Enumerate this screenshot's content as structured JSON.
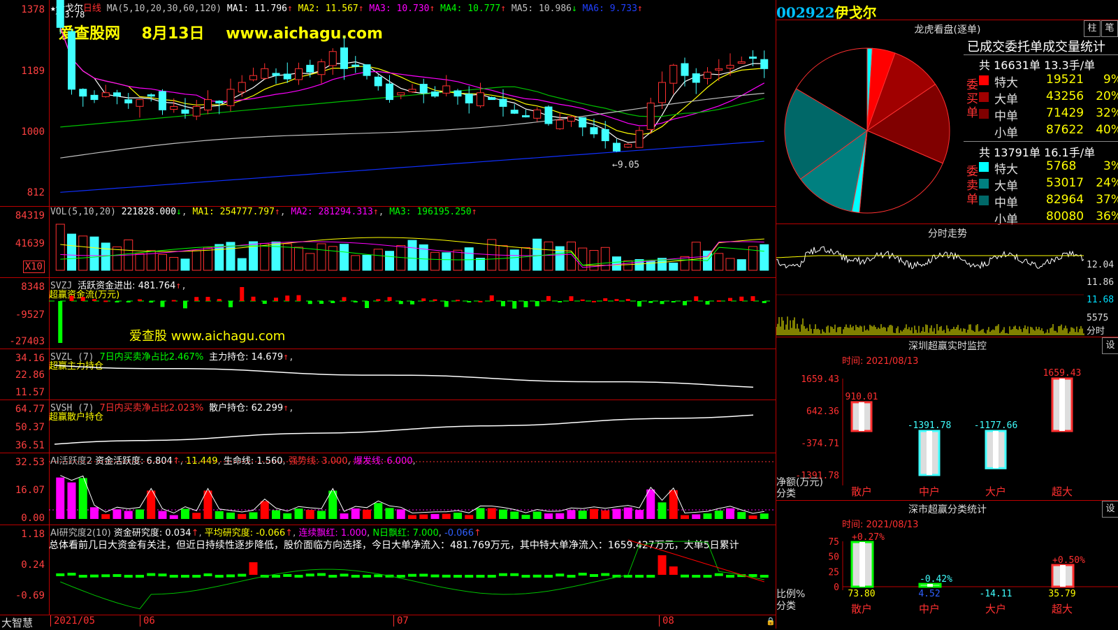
{
  "header": {
    "star": "★",
    "stock_name": "伊戈尔",
    "period": "日线",
    "ma_params": "MA(5,10,20,30,60,120)",
    "ma": [
      {
        "label": "MA1:",
        "value": "11.796",
        "arrow": "↑",
        "color": "#ffffff"
      },
      {
        "label": "MA2:",
        "value": "11.567",
        "arrow": "↑",
        "color": "#ffff00"
      },
      {
        "label": "MA3:",
        "value": "10.730",
        "arrow": "↑",
        "color": "#ff00ff"
      },
      {
        "label": "MA4:",
        "value": "10.777",
        "arrow": "↑",
        "color": "#00ff00"
      },
      {
        "label": "MA5:",
        "value": "10.986",
        "arrow": "↓",
        "color": "#c0c0c0"
      },
      {
        "label": "MA6:",
        "value": "9.733",
        "arrow": "↑",
        "color": "#2040ff"
      }
    ],
    "high_marker": "13.78",
    "watermark": "爱查股网    8月13日    www.aichagu.com",
    "low_marker": "9.05"
  },
  "price_axis": [
    "1378",
    "1189",
    "1000",
    "812"
  ],
  "vol": {
    "header": "VOL(5,10,20)",
    "value": "221828.000",
    "arrow": "↓",
    "ma1": "MA1: 254777.797",
    "ma2": "MA2: 281294.313",
    "ma3": "MA3: 196195.250",
    "axis": [
      "84319",
      "41639"
    ],
    "unit": "X10"
  },
  "svzj": {
    "header": "SVZJ",
    "label": "活跃资金进出: 481.764",
    "sub": "超赢资金流(万元)",
    "axis": [
      "8348",
      "-9527",
      "-27403"
    ],
    "watermark": "爱查股 www.aichagu.com"
  },
  "svzl": {
    "header": "SVZL (7)",
    "ratio": "7日内买卖净占比2.467%",
    "label": "主力持仓: 14.679",
    "sub": "超赢主力持仓",
    "axis": [
      "34.16",
      "22.86",
      "11.57"
    ]
  },
  "svsh": {
    "header": "SVSH (7)",
    "ratio": "7日内买卖净占比2.023%",
    "label": "散户持仓: 62.299",
    "sub": "超赢散户持仓",
    "axis": [
      "64.77",
      "50.37",
      "36.51"
    ]
  },
  "ai_active": {
    "header": "AI活跃度2",
    "label": "资金活跃度: 6.804",
    "v2": "11.449",
    "life": "生命线: 1.560",
    "strong": "强势线: 3.000",
    "burst": "爆发线: 6.000",
    "axis": [
      "32.53",
      "16.07",
      "0.00"
    ]
  },
  "ai_research": {
    "header": "AI研究度2(10)",
    "label": "资金研究度: 0.034",
    "avg": "平均研究度: -0.066",
    "cont": "连续飘红: 1.000",
    "nday": "N日飘红: 7.000",
    "last": "-0.066",
    "text": "总体看前几日大资金有关注，但近日持续性逐步降低，股价面临方向选择，今日大单净流入：481.769万元，其中特大单净流入：1659.427万元，大单5日累计",
    "axis": [
      "1.18",
      "0.24",
      "-0.69"
    ]
  },
  "bottom_axis": {
    "brand": "大智慧",
    "dates": [
      "2021/05",
      "06",
      "07",
      "08"
    ]
  },
  "right": {
    "code": "002922",
    "name": "伊戈尔",
    "dragon_title": "龙虎看盘(逐单)",
    "btn_zhu": "柱",
    "btn_bi": "笔",
    "stat_title": "已成交委托单成交量统计",
    "buy_total": "共 16631单 13.3手/单",
    "buy_label": "委买单",
    "buy": [
      {
        "name": "特大",
        "value": "19521",
        "pct": "9%",
        "color": "#ff0000"
      },
      {
        "name": "大单",
        "value": "43256",
        "pct": "20%",
        "color": "#a00000"
      },
      {
        "name": "中单",
        "value": "71429",
        "pct": "32%",
        "color": "#800000"
      },
      {
        "name": "小单",
        "value": "87622",
        "pct": "40%",
        "color": "#000000"
      }
    ],
    "sell_total": "共 13791单 16.1手/单",
    "sell_label": "委卖单",
    "sell": [
      {
        "name": "特大",
        "value": "5768",
        "pct": "3%",
        "color": "#00ffff"
      },
      {
        "name": "大单",
        "value": "53017",
        "pct": "24%",
        "color": "#008080"
      },
      {
        "name": "中单",
        "value": "82964",
        "pct": "37%",
        "color": "#006868"
      },
      {
        "name": "小单",
        "value": "80080",
        "pct": "36%",
        "color": "#000000"
      }
    ],
    "pie_data": [
      {
        "pct": 1,
        "color": "#00ffff"
      },
      {
        "pct": 4.5,
        "color": "#ff0000"
      },
      {
        "pct": 10,
        "color": "#a00000"
      },
      {
        "pct": 16,
        "color": "#800000"
      },
      {
        "pct": 20,
        "color": "#000000"
      },
      {
        "pct": 1.5,
        "color": "#00ffff"
      },
      {
        "pct": 12,
        "color": "#008080"
      },
      {
        "pct": 18.5,
        "color": "#006868"
      },
      {
        "pct": 16.5,
        "color": "#000000"
      }
    ],
    "trend_title": "分时走势",
    "trend_axis": [
      "12.04",
      "11.86",
      "11.68"
    ],
    "trend_vol": "5575",
    "trend_vol_unit": "分时",
    "sz_title": "深圳超赢实时监控",
    "sz_btn": "设",
    "sz_time": "时间: 2021/08/13",
    "sz_axis": [
      "1659.43",
      "642.36",
      "-374.71",
      "-1391.78"
    ],
    "sz_unit1": "净额(万元)",
    "sz_unit2": "分类",
    "sz_bars": [
      {
        "cat": "散户",
        "value": 910.01,
        "label": "910.01"
      },
      {
        "cat": "中户",
        "value": -1391.78,
        "label": "-1391.78"
      },
      {
        "cat": "大户",
        "value": -1177.66,
        "label": "-1177.66"
      },
      {
        "cat": "超大",
        "value": 1659.43,
        "label": "1659.43"
      }
    ],
    "cls_title": "深市超赢分类统计",
    "cls_btn": "设",
    "cls_time": "时间: 2021/08/13",
    "cls_axis": [
      "75",
      "50",
      "25",
      "0"
    ],
    "cls_unit1": "比例%",
    "cls_unit2": "分类",
    "cls_bars": [
      {
        "cat": "散户",
        "ratio": 73.8,
        "label": "73.80",
        "pct": "+0.27%"
      },
      {
        "cat": "中户",
        "ratio": 4.52,
        "label": "4.52",
        "pct": "-0.42%"
      },
      {
        "cat": "大户",
        "ratio": -14.11,
        "label": "-14.11",
        "pct": ""
      },
      {
        "cat": "超大",
        "ratio": 35.79,
        "label": "35.79",
        "pct": "+0.50%"
      }
    ]
  },
  "chart_data": {
    "type": "bar",
    "title": "深圳超赢实时监控",
    "categories": [
      "散户",
      "中户",
      "大户",
      "超大"
    ],
    "values": [
      910.01,
      -1391.78,
      -1177.66,
      1659.43
    ],
    "ylabel": "净额(万元)",
    "ylim": [
      -1391.78,
      1659.43
    ]
  }
}
